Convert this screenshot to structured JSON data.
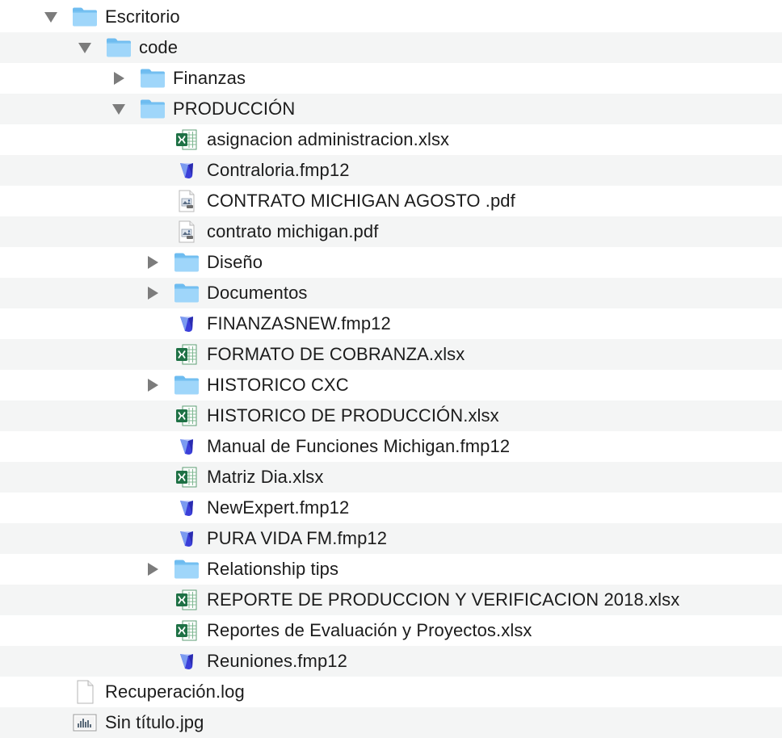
{
  "colors": {
    "folder_top": "#7fc6f3",
    "folder_body": "#a9dbfb",
    "excel_green": "#1e7145",
    "filemaker_blue": "#3b3fd9",
    "row_alt": "#f4f5f5",
    "disclosure_gray": "#7c7c7c"
  },
  "items": [
    {
      "label": "Escritorio",
      "icon": "folder-icon",
      "expanded": true
    },
    {
      "label": "code",
      "icon": "folder-icon",
      "expanded": true
    },
    {
      "label": "Finanzas",
      "icon": "folder-icon",
      "expanded": false
    },
    {
      "label": "PRODUCCIÓN",
      "icon": "folder-icon",
      "expanded": true
    },
    {
      "label": "asignacion administracion.xlsx",
      "icon": "excel-icon"
    },
    {
      "label": "Contraloria.fmp12",
      "icon": "filemaker-icon"
    },
    {
      "label": "CONTRATO MICHIGAN AGOSTO .pdf",
      "icon": "pdf-icon"
    },
    {
      "label": "contrato michigan.pdf",
      "icon": "pdf-icon"
    },
    {
      "label": "Diseño",
      "icon": "folder-icon",
      "expanded": false
    },
    {
      "label": "Documentos",
      "icon": "folder-icon",
      "expanded": false
    },
    {
      "label": "FINANZASNEW.fmp12",
      "icon": "filemaker-icon"
    },
    {
      "label": "FORMATO DE COBRANZA.xlsx",
      "icon": "excel-icon"
    },
    {
      "label": "HISTORICO CXC",
      "icon": "folder-icon",
      "expanded": false
    },
    {
      "label": "HISTORICO DE PRODUCCIÓN.xlsx",
      "icon": "excel-icon"
    },
    {
      "label": "Manual de Funciones Michigan.fmp12",
      "icon": "filemaker-icon"
    },
    {
      "label": "Matriz Dia.xlsx",
      "icon": "excel-icon"
    },
    {
      "label": "NewExpert.fmp12",
      "icon": "filemaker-icon"
    },
    {
      "label": "PURA VIDA FM.fmp12",
      "icon": "filemaker-icon"
    },
    {
      "label": "Relationship tips",
      "icon": "folder-icon",
      "expanded": false
    },
    {
      "label": "REPORTE DE PRODUCCION Y VERIFICACION 2018.xlsx",
      "icon": "excel-icon"
    },
    {
      "label": "Reportes de Evaluación y Proyectos.xlsx",
      "icon": "excel-icon"
    },
    {
      "label": "Reuniones.fmp12",
      "icon": "filemaker-icon"
    },
    {
      "label": "Recuperación.log",
      "icon": "text-file-icon"
    },
    {
      "label": "Sin título.jpg",
      "icon": "image-file-icon"
    }
  ]
}
